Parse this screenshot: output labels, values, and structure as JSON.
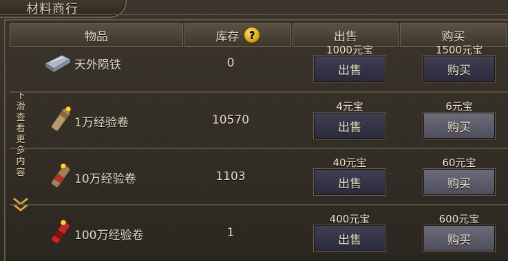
{
  "window": {
    "title": "材料商行"
  },
  "header": {
    "item": "物品",
    "stock": "库存",
    "stock_help_icon": "question-icon",
    "sell": "出售",
    "buy": "购买"
  },
  "scroll_hint": {
    "text": "下滑查看更多内容",
    "icon": "double-chevron-down-icon"
  },
  "rows": [
    {
      "name": "天外陨铁",
      "icon": "iron-ingot-icon",
      "stock": "0",
      "sell_price": "1000元宝",
      "buy_price": "1500元宝",
      "sell_label": "出售",
      "buy_label": "购买"
    },
    {
      "name": "1万经验卷",
      "icon": "scroll-icon",
      "stock": "10570",
      "sell_price": "4元宝",
      "buy_price": "6元宝",
      "sell_label": "出售",
      "buy_label": "购买"
    },
    {
      "name": "10万经验卷",
      "icon": "scroll-icon",
      "stock": "1103",
      "sell_price": "40元宝",
      "buy_price": "60元宝",
      "sell_label": "出售",
      "buy_label": "购买"
    },
    {
      "name": "100万经验卷",
      "icon": "scroll-icon",
      "stock": "1",
      "sell_price": "400元宝",
      "buy_price": "600元宝",
      "sell_label": "出售",
      "buy_label": "购买"
    }
  ],
  "colors": {
    "gold": "#d39a10",
    "frame": "#6a5d48"
  }
}
